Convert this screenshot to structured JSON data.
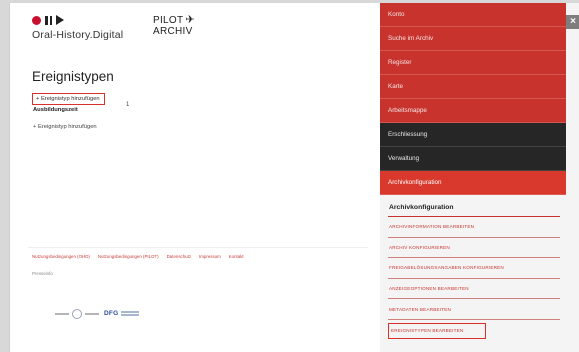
{
  "logo": {
    "name": "Oral-History.Digital"
  },
  "pilot": {
    "line1": "PILOT",
    "line2": "ARCHIV"
  },
  "page": {
    "title": "Ereignistypen",
    "add_event_top": "+ Ereignistyp hinzufügen",
    "section_label": "Ausbildungszeit",
    "small_marker": "1",
    "add_event_bottom": "+ Ereignistyp hinzufügen"
  },
  "footer": {
    "links": [
      "Nutzungsbedingungen (OHD)",
      "Nutzungsbedingungen (PILOT)",
      "Datenschutz",
      "Impressum",
      "Kontakt"
    ],
    "sub": "Presseinfo"
  },
  "partners": {
    "second": "DFG"
  },
  "menu": {
    "items": [
      {
        "label": "Konto"
      },
      {
        "label": "Suche im Archiv"
      },
      {
        "label": "Register"
      },
      {
        "label": "Karte"
      },
      {
        "label": "Arbeitsmappe"
      },
      {
        "label": "Erschliessung"
      },
      {
        "label": "Verwaltung"
      },
      {
        "label": "Archivkonfiguration"
      }
    ],
    "close": "×"
  },
  "submenu": {
    "title": "Archivkonfiguration",
    "items": [
      "ARCHIVINFORMATION BEARBEITEN",
      "ARCHIV KONFIGURIEREN",
      "FREIGABELÖSUNGSANGABEN KONFIGURIEREN",
      "ANZEIGEOPTIONEN BEARBEITEN",
      "METADATEN BEARBEITEN",
      "EREIGNISTYPEN BEARBEITEN"
    ]
  },
  "colors": {
    "accent": "#c9332d",
    "dark_menu": "#262626",
    "active": "#d8392c"
  }
}
